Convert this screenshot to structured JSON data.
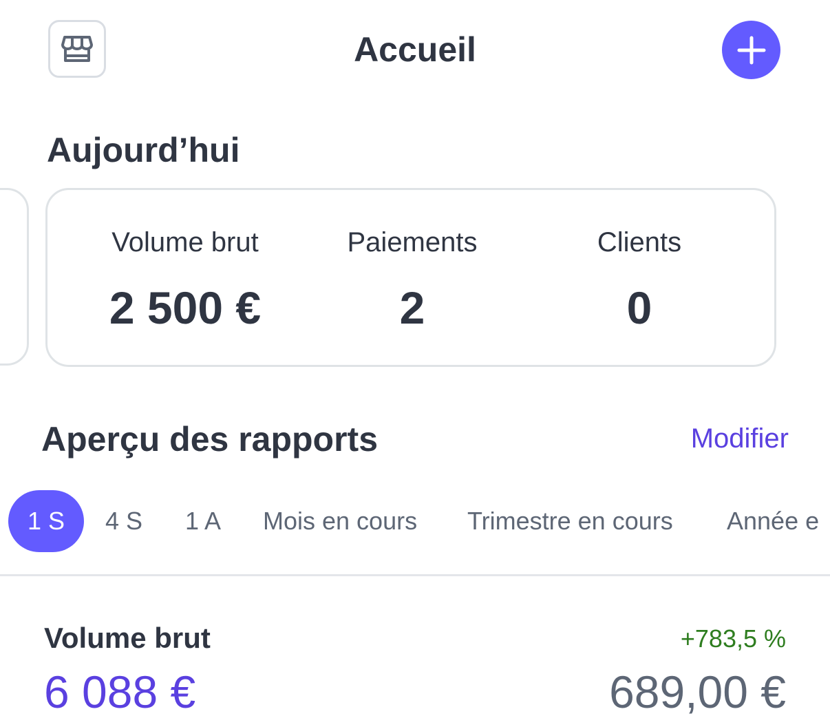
{
  "header": {
    "title": "Accueil",
    "store_icon": "storefront-icon",
    "add_icon": "plus-icon",
    "accent_color": "#635bff"
  },
  "today": {
    "title": "Aujourd’hui",
    "stats": [
      {
        "label": "Volume brut",
        "value": "2 500 €"
      },
      {
        "label": "Paiements",
        "value": "2"
      },
      {
        "label": "Clients",
        "value": "0"
      }
    ]
  },
  "reports": {
    "title": "Aperçu des rapports",
    "modify_label": "Modifier",
    "tabs": [
      {
        "label": "1 S",
        "active": true
      },
      {
        "label": "4 S",
        "active": false
      },
      {
        "label": "1 A",
        "active": false
      },
      {
        "label": "Mois en cours",
        "active": false
      },
      {
        "label": "Trimestre en cours",
        "active": false
      },
      {
        "label": "Année e",
        "active": false
      }
    ],
    "metric": {
      "label": "Volume brut",
      "change": "+783,5 %",
      "value": "6 088 €",
      "compare_value": "689,00 €",
      "change_color": "#2e7d1f"
    }
  }
}
